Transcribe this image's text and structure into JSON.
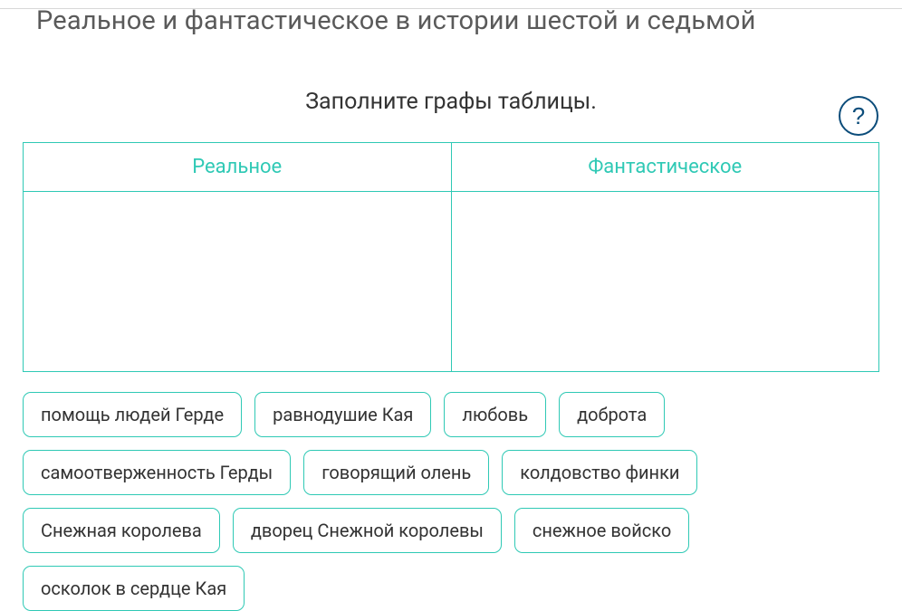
{
  "header": {
    "title": "Реальное и фантастическое в истории шестой и седьмой"
  },
  "instruction": "Заполните графы таблицы.",
  "help": {
    "label": "?"
  },
  "table": {
    "columns": [
      {
        "label": "Реальное"
      },
      {
        "label": "Фантастическое"
      }
    ]
  },
  "chips": [
    {
      "label": "помощь людей Герде"
    },
    {
      "label": "равнодушие Кая"
    },
    {
      "label": "любовь"
    },
    {
      "label": "доброта"
    },
    {
      "label": "самоотверженность Герды"
    },
    {
      "label": "говорящий олень"
    },
    {
      "label": "колдовство финки"
    },
    {
      "label": "Снежная королева"
    },
    {
      "label": "дворец Снежной королевы"
    },
    {
      "label": "снежное войско"
    },
    {
      "label": "осколок в сердце Кая"
    }
  ]
}
